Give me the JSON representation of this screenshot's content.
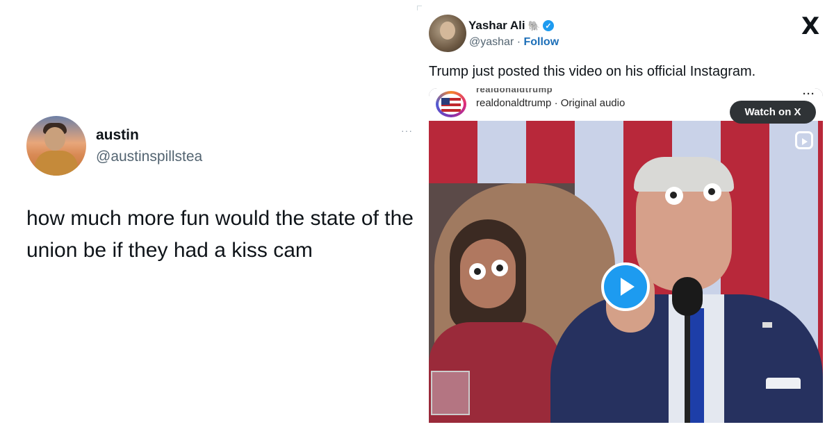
{
  "left_tweet": {
    "name": "austin",
    "handle": "@austinspillstea",
    "more": "···",
    "text": "how much more fun would the state of the union be if they had a kiss cam"
  },
  "right_tweet": {
    "name": "Yashar Ali",
    "emoji": "🐘",
    "handle": "@yashar",
    "separator": " · ",
    "follow_label": "Follow",
    "logo": "X",
    "text": "Trump just posted this video on his official Instagram.",
    "media": {
      "cut_name": "realdonaldtrump",
      "username": "realdonaldtrump",
      "audio": "Original audio",
      "more": "···",
      "watch_label": "Watch on X"
    }
  },
  "icons": {
    "verified": "verified-badge-icon",
    "play": "play-icon",
    "reels": "reels-icon",
    "x_logo": "x-logo-icon"
  },
  "colors": {
    "accent": "#1d9bf0",
    "follow": "#1d6fb8",
    "secondary_text": "#536471"
  }
}
